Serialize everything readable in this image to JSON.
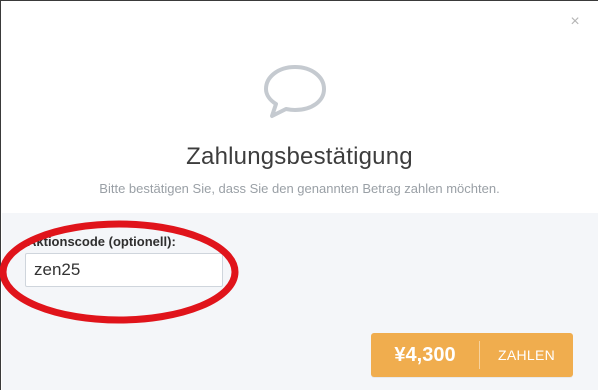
{
  "modal": {
    "close_symbol": "×",
    "icon": "speech-bubble-icon",
    "title": "Zahlungsbestätigung",
    "subtitle": "Bitte bestätigen Sie, dass Sie den genannten Betrag zahlen möchten."
  },
  "promo": {
    "label": "Aktionscode (optionell):",
    "value": "zen25"
  },
  "pay_button": {
    "amount": "¥4,300",
    "label": "ZAHLEN"
  },
  "colors": {
    "accent": "#f0ad4e",
    "annotation": "#e0141b",
    "panel_bg": "#f4f6f9"
  }
}
